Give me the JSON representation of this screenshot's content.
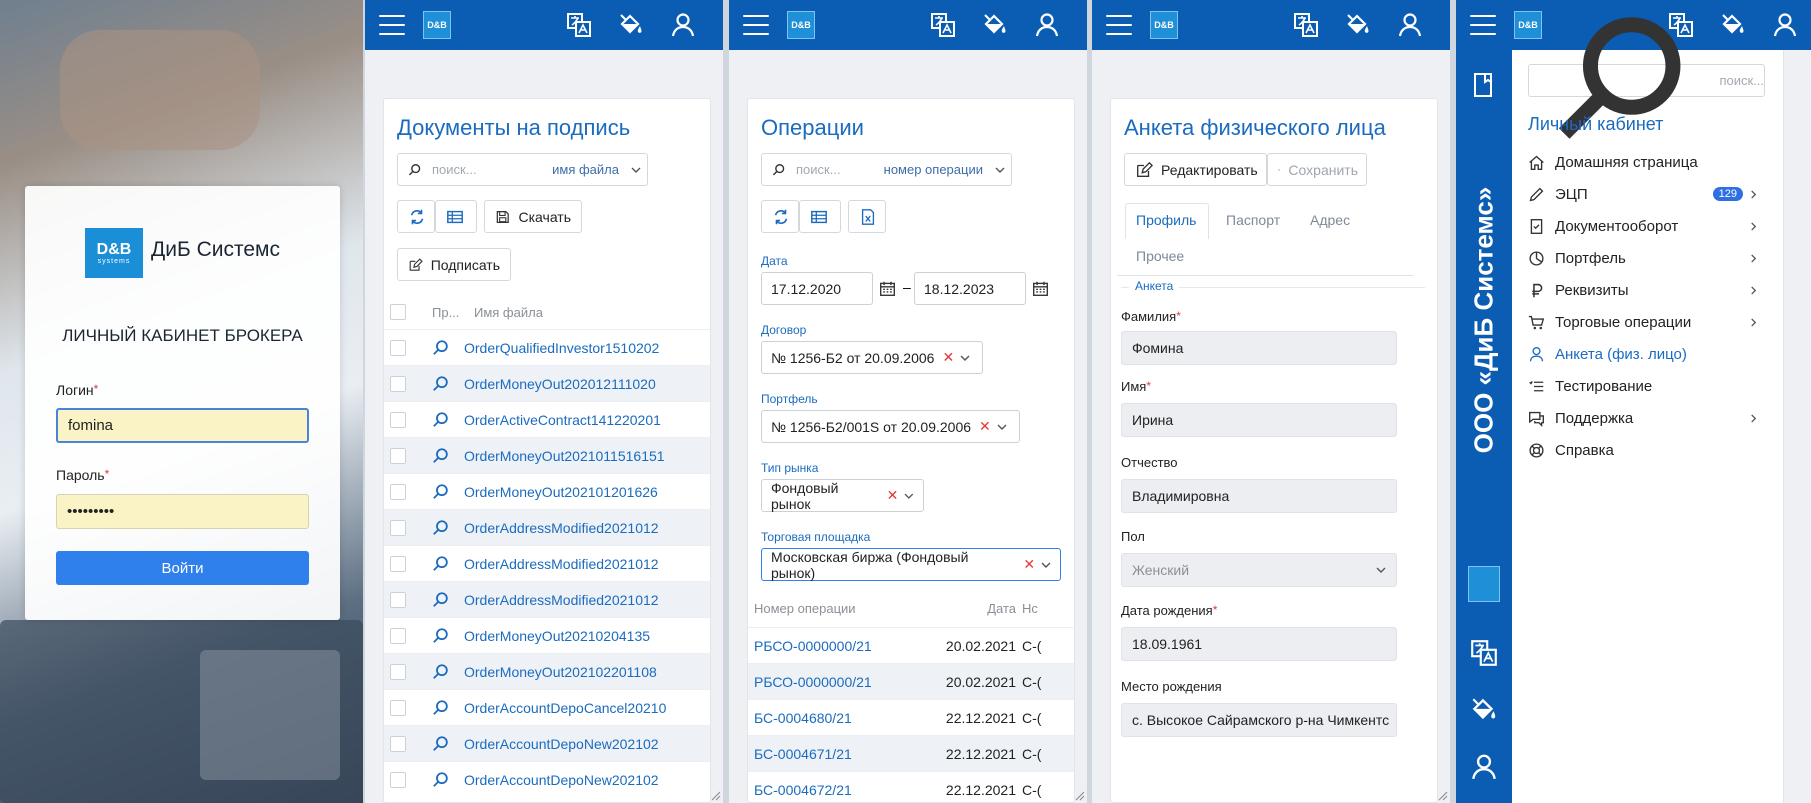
{
  "login": {
    "brand_logo": "D&B",
    "brand_logo_sub": "systems",
    "brand_name": "ДиБ Системс",
    "heading": "ЛИЧНЫЙ КАБИНЕТ БРОКЕРА",
    "login_label": "Логин",
    "login_value": "fomina",
    "password_label": "Пароль",
    "password_value": "•••••••••",
    "submit_label": "Войти"
  },
  "topbar": {
    "logo": "D&B",
    "icons": [
      "translate-icon",
      "paint-bucket-icon",
      "user-icon"
    ]
  },
  "documents": {
    "title": "Документы на подпись",
    "search_placeholder": "поиск...",
    "search_field": "имя файла",
    "download_label": "Скачать",
    "sign_label": "Подписать",
    "col_preview": "Пр...",
    "col_filename": "Имя файла",
    "rows": [
      "OrderQualifiedInvestor1510202",
      "OrderMoneyOut202012111020",
      "OrderActiveContract141220201",
      "OrderMoneyOut2021011516151",
      "OrderMoneyOut202101201626",
      "OrderAddressModified2021012",
      "OrderAddressModified2021012",
      "OrderAddressModified2021012",
      "OrderMoneyOut20210204135",
      "OrderMoneyOut202102201108",
      "OrderAccountDepoCancel20210",
      "OrderAccountDepoNew202102",
      "OrderAccountDepoNew202102"
    ]
  },
  "operations": {
    "title": "Операции",
    "search_placeholder": "поиск...",
    "search_field": "номер операции",
    "date_label": "Дата",
    "date_from": "17.12.2020",
    "date_sep": "–",
    "date_to": "18.12.2023",
    "contract_label": "Договор",
    "contract_value": "№ 1256-Б2 от 20.09.2006",
    "portfolio_label": "Портфель",
    "portfolio_value": "№ 1256-Б2/001S от 20.09.2006",
    "market_label": "Тип рынка",
    "market_value": "Фондовый рынок",
    "venue_label": "Торговая площадка",
    "venue_value": "Московская биржа (Фондовый рынок)",
    "col_number": "Номер операции",
    "col_date": "Дата",
    "col_extra": "Нс",
    "rows": [
      {
        "number": "РБСО-0000000/21",
        "date": "20.02.2021",
        "extra": "С-("
      },
      {
        "number": "РБСО-0000000/21",
        "date": "20.02.2021",
        "extra": "С-("
      },
      {
        "number": "БС-0004680/21",
        "date": "22.12.2021",
        "extra": "С-("
      },
      {
        "number": "БС-0004671/21",
        "date": "22.12.2021",
        "extra": "С-("
      },
      {
        "number": "БС-0004672/21",
        "date": "22.12.2021",
        "extra": "С-("
      }
    ]
  },
  "anketa": {
    "title": "Анкета физического лица",
    "edit_label": "Редактировать",
    "save_label": "Сохранить",
    "tabs": [
      "Профиль",
      "Паспорт",
      "Адрес",
      "Прочее"
    ],
    "section": "Анкета",
    "surname_label": "Фамилия",
    "surname_value": "Фомина",
    "name_label": "Имя",
    "name_value": "Ирина",
    "patronymic_label": "Отчество",
    "patronymic_value": "Владимировна",
    "gender_label": "Пол",
    "gender_value": "Женский",
    "birthdate_label": "Дата рождения",
    "birthdate_value": "18.09.1961",
    "birthplace_label": "Место рождения",
    "birthplace_value": "с. Высокое Сайрамского р-на Чимкентс"
  },
  "menu": {
    "vertical_title": "ООО «ДиБ Системс»",
    "search_placeholder": "поиск...",
    "heading": "Личный кабинет",
    "items": [
      {
        "label": "Домашняя страница"
      },
      {
        "label": "ЭЦП",
        "badge": "129"
      },
      {
        "label": "Документооборот"
      },
      {
        "label": "Портфель"
      },
      {
        "label": "Реквизиты"
      },
      {
        "label": "Торговые операции"
      },
      {
        "label": "Анкета (физ. лицо)"
      },
      {
        "label": "Тестирование"
      },
      {
        "label": "Поддержка"
      },
      {
        "label": "Справка"
      }
    ]
  },
  "colors": {
    "primary": "#0a5db3",
    "link": "#1b6bbf",
    "button": "#2f80ed",
    "required": "#e03a3a"
  }
}
